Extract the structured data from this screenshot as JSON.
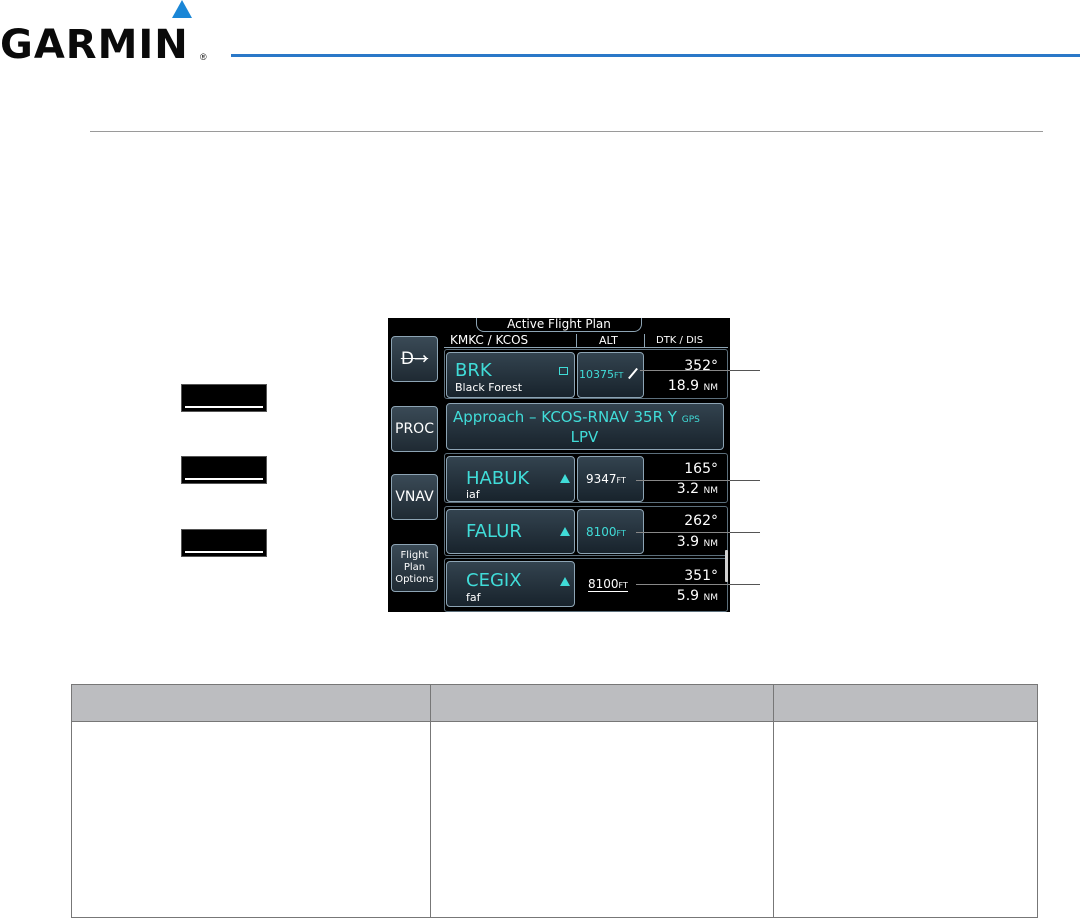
{
  "header": {
    "logo_text": "GARMIN",
    "registered_mark": "®",
    "accent_color": "#1a86d6"
  },
  "screen": {
    "title": "Active Flight Plan",
    "route": "KMKC / KCOS",
    "col_alt": "ALT",
    "col_dtk_dis": "DTK / DIS",
    "side_buttons": {
      "direct_to": "D→",
      "proc": "PROC",
      "vnav": "VNAV",
      "options_line1": "Flight",
      "options_line2": "Plan",
      "options_line3": "Options"
    },
    "procedure": {
      "line1": "Approach – KCOS-RNAV 35R Y",
      "gps": "GPS",
      "line2": "LPV"
    },
    "waypoints": [
      {
        "name": "BRK",
        "sub": "Black Forest",
        "alt": "10375",
        "alt_unit": "FT",
        "dtk": "352°",
        "dis": "18.9",
        "dis_unit": "NM"
      },
      {
        "name": "HABUK",
        "sub": "iaf",
        "alt": "9347",
        "alt_unit": "FT",
        "dtk": "165°",
        "dis": "3.2",
        "dis_unit": "NM"
      },
      {
        "name": "FALUR",
        "sub": "",
        "alt": "8100",
        "alt_unit": "FT",
        "dtk": "262°",
        "dis": "3.9",
        "dis_unit": "NM"
      },
      {
        "name": "CEGIX",
        "sub": "faf",
        "alt": "8100",
        "alt_unit": "FT",
        "dtk": "351°",
        "dis": "5.9",
        "dis_unit": "NM"
      }
    ],
    "colors": {
      "cyan": "#40dcd8",
      "white": "#ffffff",
      "background": "#000000"
    }
  },
  "table": {
    "header_color": "#bcbdc0"
  }
}
